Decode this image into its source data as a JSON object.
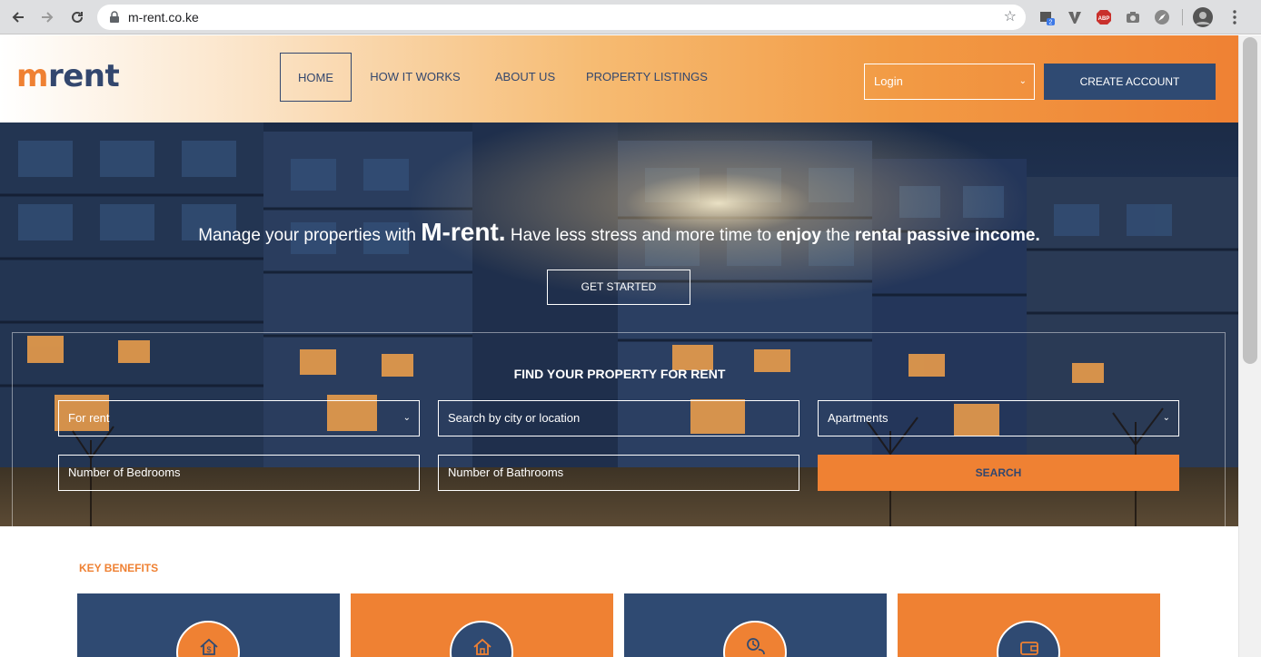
{
  "browser": {
    "url": "m-rent.co.ke",
    "extension_badge": "2",
    "abp_label": "ABP"
  },
  "header": {
    "logo_m": "m",
    "logo_rest": "rent",
    "nav": [
      "HOME",
      "HOW IT WORKS",
      "ABOUT US",
      "PROPERTY LISTINGS"
    ],
    "login_selected": "Login",
    "create_account": "CREATE ACCOUNT"
  },
  "hero": {
    "text_1": "Manage your properties with ",
    "brand": "M-rent.",
    "text_2": " Have less stress and more time to ",
    "bold_1": "enjoy",
    "text_3": " the ",
    "bold_2": "rental passive income.",
    "cta": "GET STARTED"
  },
  "search": {
    "title": "FIND YOUR PROPERTY FOR RENT",
    "type_selected": "For rent",
    "location_placeholder": "Search by city or location",
    "category_selected": "Apartments",
    "bedrooms_placeholder": "Number of Bedrooms",
    "bathrooms_placeholder": "Number of Bathrooms",
    "button": "SEARCH"
  },
  "benefits": {
    "title": "KEY BENEFITS",
    "icons": [
      "house-dollar-icon",
      "house-key-icon",
      "time-money-icon",
      "wallet-icon"
    ]
  },
  "colors": {
    "brand_orange": "#ef8133",
    "brand_navy": "#2f4a72"
  }
}
